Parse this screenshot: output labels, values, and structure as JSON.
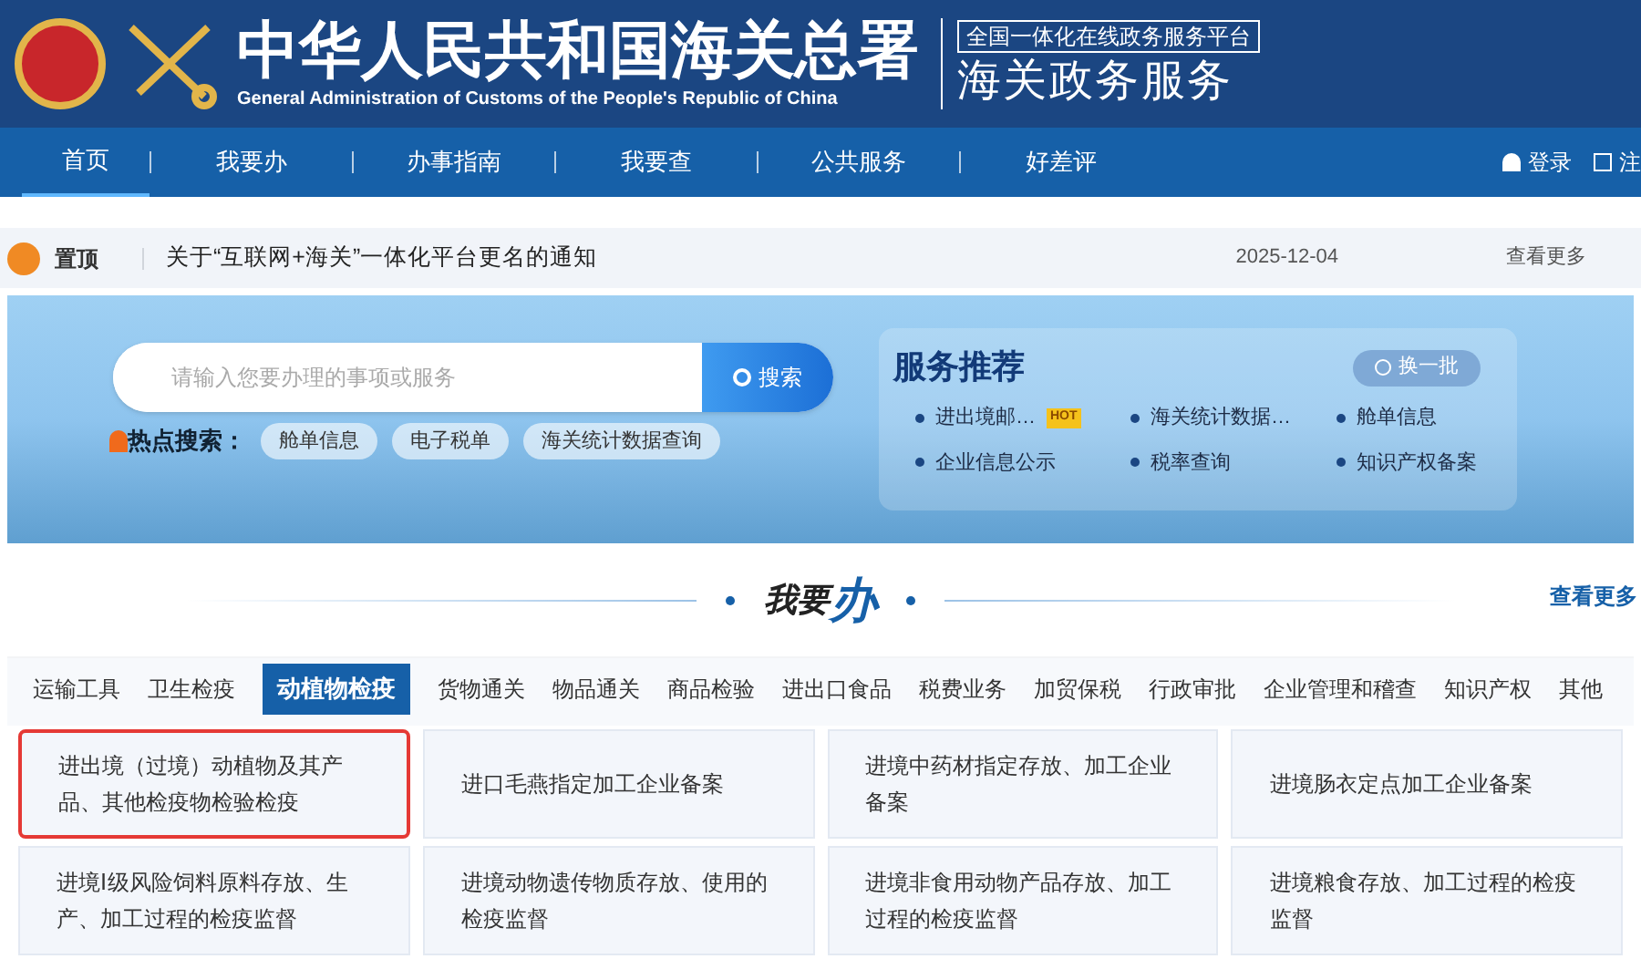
{
  "header": {
    "title": "中华人民共和国海关总署",
    "subtitle": "General Administration of Customs of the People's Republic of China",
    "platform_tag": "全国一体化在线政务服务平台",
    "platform_name": "海关政务服务"
  },
  "nav": {
    "items": [
      {
        "label": "首页",
        "selected": true
      },
      {
        "label": "我要办",
        "selected": false
      },
      {
        "label": "办事指南",
        "selected": false
      },
      {
        "label": "我要查",
        "selected": false
      },
      {
        "label": "公共服务",
        "selected": false
      },
      {
        "label": "好差评",
        "selected": false
      }
    ],
    "login": "登录",
    "register": "注"
  },
  "notice": {
    "badge": "置顶",
    "text": "关于“互联网+海关”一体化平台更名的通知",
    "date": "2025-12-04",
    "more": "查看更多"
  },
  "search": {
    "placeholder": "请输入您要办理的事项或服务",
    "button": "搜索",
    "hot_label": "热点搜索：",
    "hot_tags": [
      "舱单信息",
      "电子税单",
      "海关统计数据查询"
    ]
  },
  "recommend": {
    "title": "服务推荐",
    "refresh": "换一批",
    "items": [
      {
        "label": "进出境邮…",
        "badge": "HOT"
      },
      {
        "label": "海关统计数据…"
      },
      {
        "label": "舱单信息"
      },
      {
        "label": "企业信息公示"
      },
      {
        "label": "税率查询"
      },
      {
        "label": "知识产权备案"
      }
    ]
  },
  "section": {
    "title_prefix": "我要",
    "title_emphasis": "办",
    "more": "查看更多"
  },
  "tabs": [
    {
      "label": "运输工具",
      "selected": false
    },
    {
      "label": "卫生检疫",
      "selected": false
    },
    {
      "label": "动植物检疫",
      "selected": true
    },
    {
      "label": "货物通关",
      "selected": false
    },
    {
      "label": "物品通关",
      "selected": false
    },
    {
      "label": "商品检验",
      "selected": false
    },
    {
      "label": "进出口食品",
      "selected": false
    },
    {
      "label": "税费业务",
      "selected": false
    },
    {
      "label": "加贸保税",
      "selected": false
    },
    {
      "label": "行政审批",
      "selected": false
    },
    {
      "label": "企业管理和稽查",
      "selected": false
    },
    {
      "label": "知识产权",
      "selected": false
    },
    {
      "label": "其他",
      "selected": false
    }
  ],
  "services": [
    {
      "label": "进出境（过境）动植物及其产品、其他检疫物检验检疫",
      "highlighted": true
    },
    {
      "label": "进口毛燕指定加工企业备案",
      "highlighted": false
    },
    {
      "label": "进境中药材指定存放、加工企业备案",
      "highlighted": false
    },
    {
      "label": "进境肠衣定点加工企业备案",
      "highlighted": false
    },
    {
      "label": "进境Ⅰ级风险饲料原料存放、生产、加工过程的检疫监督",
      "highlighted": false
    },
    {
      "label": "进境动物遗传物质存放、使用的检疫监督",
      "highlighted": false
    },
    {
      "label": "进境非食用动物产品存放、加工过程的检疫监督",
      "highlighted": false
    },
    {
      "label": "进境粮食存放、加工过程的检疫监督",
      "highlighted": false
    }
  ]
}
